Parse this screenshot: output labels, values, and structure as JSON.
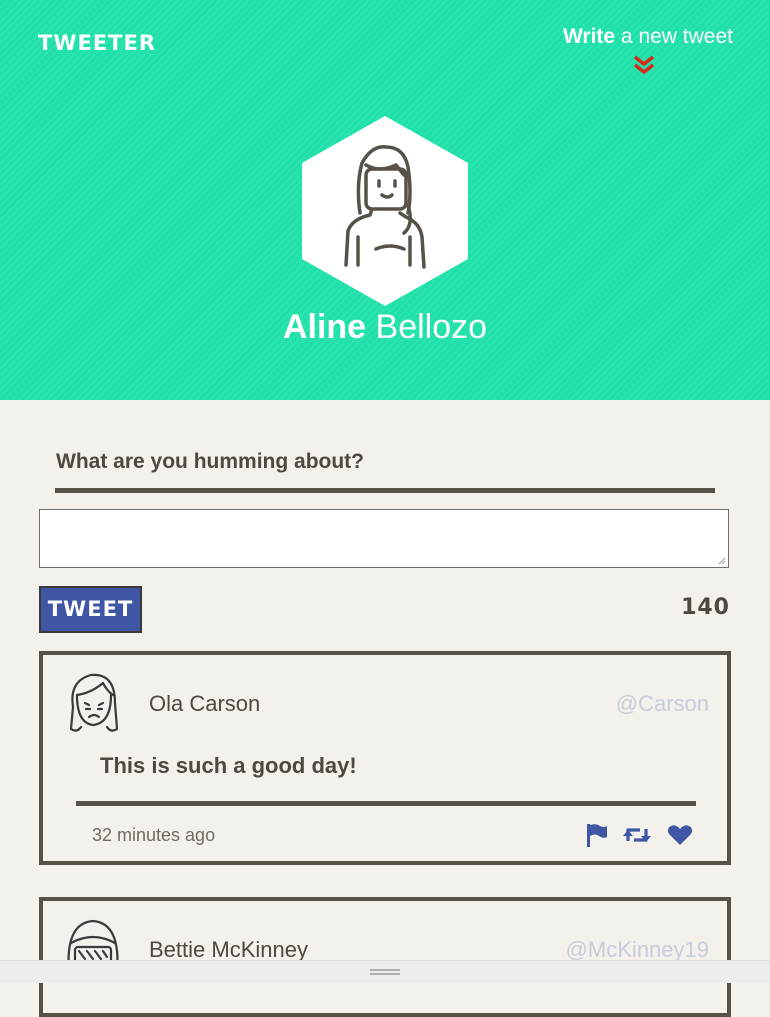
{
  "header": {
    "logo": "TWEETER",
    "write_bold": "Write",
    "write_rest": " a new tweet",
    "user_first": "Aline",
    "user_last": " Bellozo",
    "bg_color": "#22e3ac"
  },
  "composer": {
    "prompt": "What are you humming about?",
    "input_value": "",
    "button_label": "TWEET",
    "char_count": "140",
    "button_color": "#3f56a4"
  },
  "tweets": [
    {
      "name": "Ola Carson",
      "handle": "@Carson",
      "text": "This is such a good day!",
      "time": "32 minutes ago",
      "icons": [
        "flag-icon",
        "retweet-icon",
        "heart-icon"
      ]
    },
    {
      "name": "Bettie McKinney",
      "handle": "@McKinney19"
    }
  ]
}
